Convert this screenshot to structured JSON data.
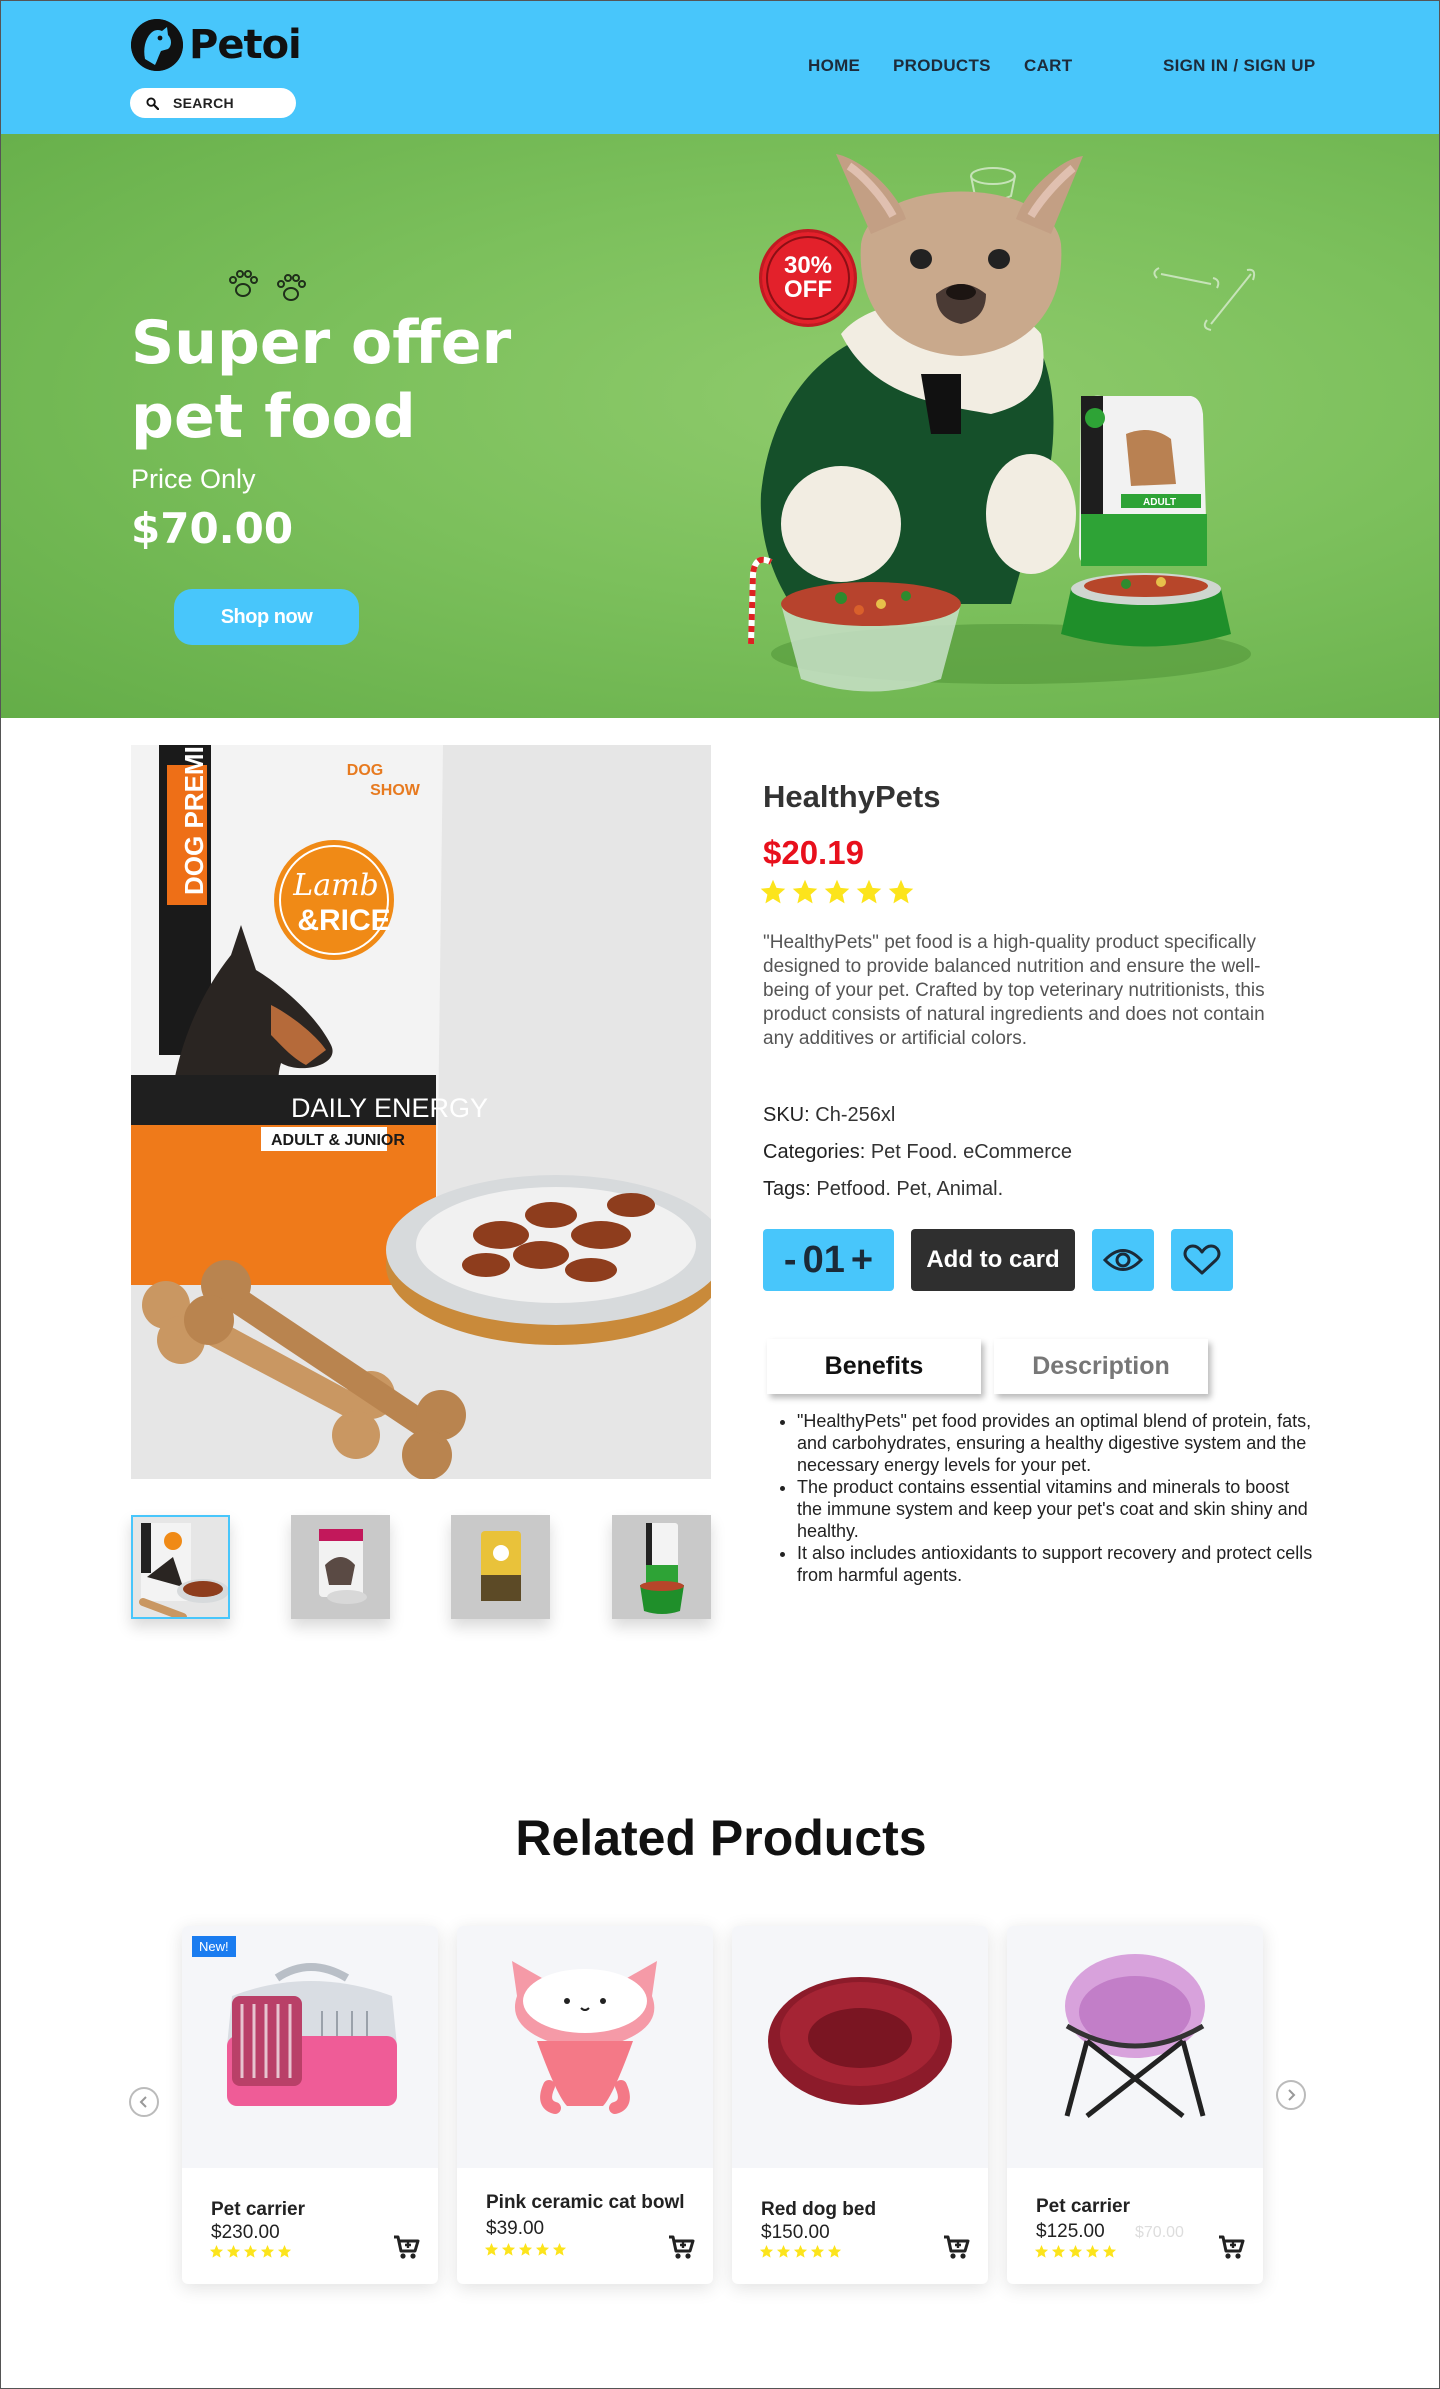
{
  "header": {
    "logo_text": "Petoi",
    "search_label": "SEARCH",
    "nav": {
      "home": "HOME",
      "products": "PRODUCTS",
      "cart": "CART",
      "auth": "SIGN IN / SIGN UP"
    }
  },
  "hero": {
    "title_line1": "Super offer",
    "title_line2": "pet food",
    "subtitle": "Price Only",
    "price": "$70.00",
    "button_label": "Shop now",
    "badge_line1": "30%",
    "badge_line2": "OFF"
  },
  "product": {
    "name": "HealthyPets",
    "price": "$20.19",
    "rating": 5,
    "description": "\"HealthyPets\" pet food is a high-quality product specifically designed to provide balanced nutrition and ensure the well-being of your pet. Crafted by top veterinary nutritionists, this product consists of natural ingredients and does not contain any additives or artificial colors.",
    "sku_label": "SKU:",
    "sku_value": "Ch-256xl",
    "categories_label": "Categories:",
    "categories_value": "Pet Food. eCommerce",
    "tags_label": "Tags:",
    "tags_value": "Petfood. Pet, Animal.",
    "quantity": "01",
    "add_to_cart_label": "Add to card",
    "package_text": {
      "brand_vertical": "DOG PREMIUM",
      "show": "DOG SHOW",
      "flavor_line1": "Lamb",
      "flavor_line2": "& RICE",
      "energy": "DAILY ENERGY",
      "age": "ADULT & JUNIOR"
    }
  },
  "tabs": {
    "benefits": "Benefits",
    "description": "Description",
    "active": "Benefits"
  },
  "benefits": [
    "\"HealthyPets\" pet food provides an optimal blend of protein, fats, and carbohydrates, ensuring a healthy digestive system and the necessary energy levels for your pet.",
    "The product contains essential vitamins and minerals to boost the immune system and keep your pet's coat and skin shiny and healthy.",
    "It also includes antioxidants to support recovery and protect cells from harmful agents."
  ],
  "related": {
    "title": "Related Products",
    "products": [
      {
        "name": "Pet carrier",
        "price": "$230.00",
        "rating": 5,
        "badge": "New!"
      },
      {
        "name": "Pink ceramic cat bowl",
        "price": "$39.00",
        "rating": 5
      },
      {
        "name": "Red dog bed",
        "price": "$150.00",
        "rating": 5
      },
      {
        "name": "Pet carrier",
        "price": "$125.00",
        "rating": 5,
        "old_price": "$70.00"
      }
    ]
  },
  "colors": {
    "accent_blue": "#48c6fb",
    "price_red": "#e8101c",
    "star_yellow": "#fce41c",
    "hero_green": "#7cc05c",
    "dark_button": "#2f2f2f"
  }
}
